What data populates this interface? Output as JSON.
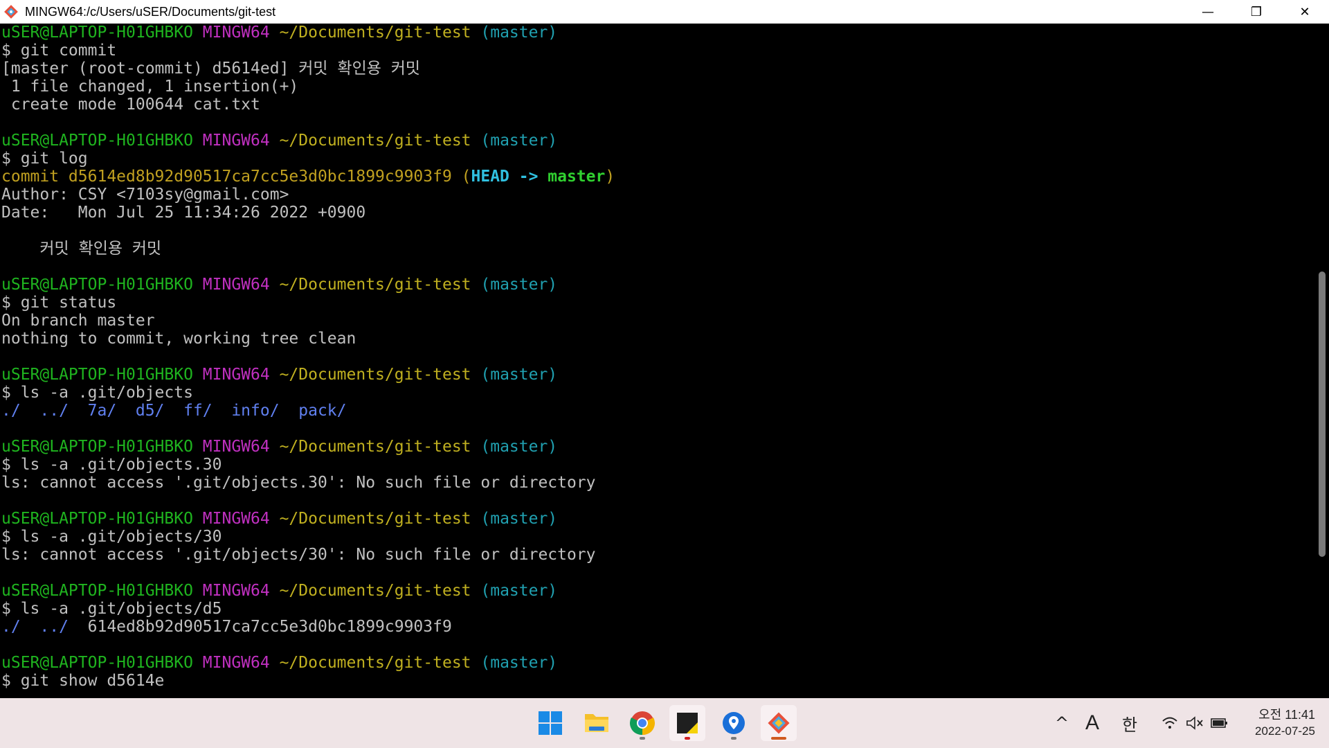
{
  "window": {
    "title": "MINGW64:/c/Users/uSER/Documents/git-test",
    "minimize_label": "—",
    "restore_label": "❐",
    "close_label": "✕"
  },
  "terminal": {
    "lines": [
      [
        {
          "t": "uSER@LAPTOP-H01GHBKO ",
          "c": "green"
        },
        {
          "t": "MINGW64 ",
          "c": "magenta"
        },
        {
          "t": "~/Documents/git-test ",
          "c": "yellow"
        },
        {
          "t": "(master)",
          "c": "cyan"
        }
      ],
      [
        {
          "t": "$ git commit",
          "c": "white"
        }
      ],
      [
        {
          "t": "[master (root-commit) d5614ed] 커밋 확인용 커밋",
          "c": "white"
        }
      ],
      [
        {
          "t": " 1 file changed, 1 insertion(+)",
          "c": "white"
        }
      ],
      [
        {
          "t": " create mode 100644 cat.txt",
          "c": "white"
        }
      ],
      [],
      [
        {
          "t": "uSER@LAPTOP-H01GHBKO ",
          "c": "green"
        },
        {
          "t": "MINGW64 ",
          "c": "magenta"
        },
        {
          "t": "~/Documents/git-test ",
          "c": "yellow"
        },
        {
          "t": "(master)",
          "c": "cyan"
        }
      ],
      [
        {
          "t": "$ git log",
          "c": "white"
        }
      ],
      [
        {
          "t": "commit d5614ed8b92d90517ca7cc5e3d0bc1899c9903f9 (",
          "c": "commit"
        },
        {
          "t": "HEAD -> ",
          "c": "head"
        },
        {
          "t": "master",
          "c": "master"
        },
        {
          "t": ")",
          "c": "commit"
        }
      ],
      [
        {
          "t": "Author: CSY <7103sy@gmail.com>",
          "c": "white"
        }
      ],
      [
        {
          "t": "Date:   Mon Jul 25 11:34:26 2022 +0900",
          "c": "white"
        }
      ],
      [],
      [
        {
          "t": "    커밋 확인용 커밋",
          "c": "white"
        }
      ],
      [],
      [
        {
          "t": "uSER@LAPTOP-H01GHBKO ",
          "c": "green"
        },
        {
          "t": "MINGW64 ",
          "c": "magenta"
        },
        {
          "t": "~/Documents/git-test ",
          "c": "yellow"
        },
        {
          "t": "(master)",
          "c": "cyan"
        }
      ],
      [
        {
          "t": "$ git status",
          "c": "white"
        }
      ],
      [
        {
          "t": "On branch master",
          "c": "white"
        }
      ],
      [
        {
          "t": "nothing to commit, working tree clean",
          "c": "white"
        }
      ],
      [],
      [
        {
          "t": "uSER@LAPTOP-H01GHBKO ",
          "c": "green"
        },
        {
          "t": "MINGW64 ",
          "c": "magenta"
        },
        {
          "t": "~/Documents/git-test ",
          "c": "yellow"
        },
        {
          "t": "(master)",
          "c": "cyan"
        }
      ],
      [
        {
          "t": "$ ls -a .git/objects",
          "c": "white"
        }
      ],
      [
        {
          "t": "./  ../  7a/  d5/  ff/  info/  pack/",
          "c": "blue"
        }
      ],
      [],
      [
        {
          "t": "uSER@LAPTOP-H01GHBKO ",
          "c": "green"
        },
        {
          "t": "MINGW64 ",
          "c": "magenta"
        },
        {
          "t": "~/Documents/git-test ",
          "c": "yellow"
        },
        {
          "t": "(master)",
          "c": "cyan"
        }
      ],
      [
        {
          "t": "$ ls -a .git/objects.30",
          "c": "white"
        }
      ],
      [
        {
          "t": "ls: cannot access '.git/objects.30': No such file or directory",
          "c": "white"
        }
      ],
      [],
      [
        {
          "t": "uSER@LAPTOP-H01GHBKO ",
          "c": "green"
        },
        {
          "t": "MINGW64 ",
          "c": "magenta"
        },
        {
          "t": "~/Documents/git-test ",
          "c": "yellow"
        },
        {
          "t": "(master)",
          "c": "cyan"
        }
      ],
      [
        {
          "t": "$ ls -a .git/objects/30",
          "c": "white"
        }
      ],
      [
        {
          "t": "ls: cannot access '.git/objects/30': No such file or directory",
          "c": "white"
        }
      ],
      [],
      [
        {
          "t": "uSER@LAPTOP-H01GHBKO ",
          "c": "green"
        },
        {
          "t": "MINGW64 ",
          "c": "magenta"
        },
        {
          "t": "~/Documents/git-test ",
          "c": "yellow"
        },
        {
          "t": "(master)",
          "c": "cyan"
        }
      ],
      [
        {
          "t": "$ ls -a .git/objects/d5",
          "c": "white"
        }
      ],
      [
        {
          "t": "./  ../  ",
          "c": "blue"
        },
        {
          "t": "614ed8b92d90517ca7cc5e3d0bc1899c9903f9",
          "c": "white"
        }
      ],
      [],
      [
        {
          "t": "uSER@LAPTOP-H01GHBKO ",
          "c": "green"
        },
        {
          "t": "MINGW64 ",
          "c": "magenta"
        },
        {
          "t": "~/Documents/git-test ",
          "c": "yellow"
        },
        {
          "t": "(master)",
          "c": "cyan"
        }
      ],
      [
        {
          "t": "$ git show d5614e",
          "c": "white"
        }
      ]
    ]
  },
  "taskbar": {
    "apps": [
      {
        "name": "start-button",
        "icon": "windows-logo-icon"
      },
      {
        "name": "file-explorer",
        "icon": "folder-icon"
      },
      {
        "name": "chrome",
        "icon": "chrome-icon"
      },
      {
        "name": "sticky-notes",
        "icon": "sticky-notes-icon"
      },
      {
        "name": "maps",
        "icon": "map-pin-icon"
      },
      {
        "name": "git-bash",
        "icon": "git-icon"
      }
    ],
    "tray": {
      "chevron": "^",
      "ime_mode": "A",
      "ime_lang": "한",
      "time": "오전 11:41",
      "date": "2022-07-25"
    }
  },
  "colors": {
    "green": "#1fb41f",
    "magenta": "#c030c0",
    "yellow": "#c0b020",
    "cyan": "#20a0b0",
    "blue": "#6080f0",
    "taskbar_bg": "#efe4e6"
  }
}
